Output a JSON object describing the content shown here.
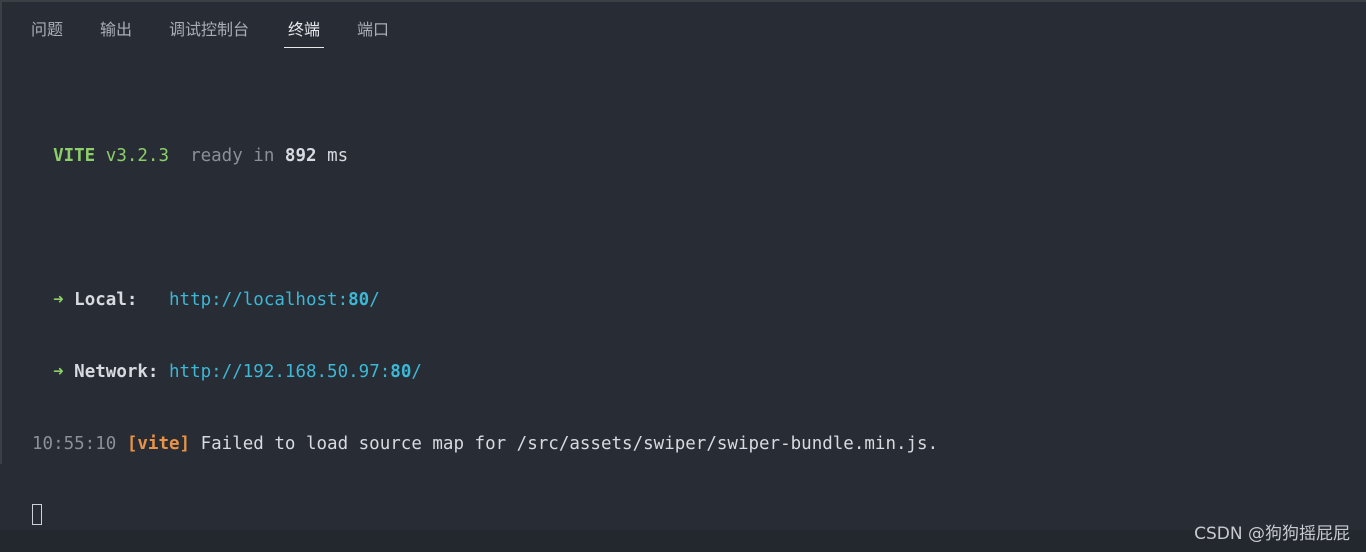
{
  "tabs": [
    {
      "label": "问题"
    },
    {
      "label": "输出"
    },
    {
      "label": "调试控制台"
    },
    {
      "label": "终端",
      "active": true
    },
    {
      "label": "端口"
    }
  ],
  "terminal": {
    "vite_label": "VITE",
    "vite_version": "v3.2.3",
    "ready_text": "ready in",
    "ready_time": "892",
    "ready_unit": "ms",
    "arrow": "➜",
    "local_label": "Local:",
    "local_url_prefix": "http://localhost:",
    "local_url_port": "80",
    "local_url_suffix": "/",
    "network_label": "Network:",
    "network_url_prefix": "http://192.168.50.97:",
    "network_url_port": "80",
    "network_url_suffix": "/",
    "log_time": "10:55:10",
    "log_tag": "[vite]",
    "log_message": "Failed to load source map for /src/assets/swiper/swiper-bundle.min.js."
  },
  "watermark": "CSDN @狗狗摇屁屁",
  "colors": {
    "background": "#282c34",
    "green": "#8ccf6a",
    "cyan": "#3cb8d6",
    "orange": "#e89347",
    "gray": "#8a8f98"
  }
}
